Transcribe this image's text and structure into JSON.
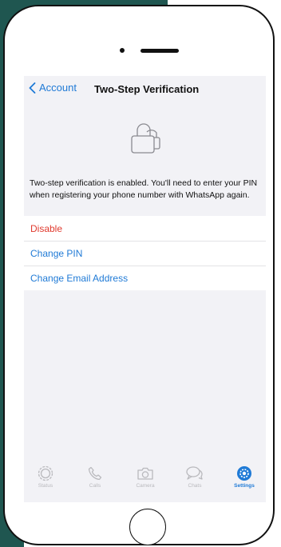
{
  "nav": {
    "back_label": "Account",
    "title": "Two-Step Verification"
  },
  "description": "Two-step verification is enabled. You'll need to enter your PIN when registering your phone number with WhatsApp again.",
  "actions": [
    {
      "label": "Disable",
      "color": "#e03a2e"
    },
    {
      "label": "Change PIN",
      "color": "#1f7ad6"
    },
    {
      "label": "Change Email Address",
      "color": "#1f7ad6"
    }
  ],
  "tabbar": {
    "tabs": [
      {
        "label": "Status",
        "icon": "status-icon"
      },
      {
        "label": "Calls",
        "icon": "phone-icon"
      },
      {
        "label": "Camera",
        "icon": "camera-icon"
      },
      {
        "label": "Chats",
        "icon": "chat-bubbles-icon"
      },
      {
        "label": "Settings",
        "icon": "gear-icon",
        "active": true
      }
    ]
  },
  "colors": {
    "accent": "#1f7ad6",
    "destructive": "#e03a2e",
    "background": "#f2f2f6",
    "frame": "#1f5650"
  }
}
